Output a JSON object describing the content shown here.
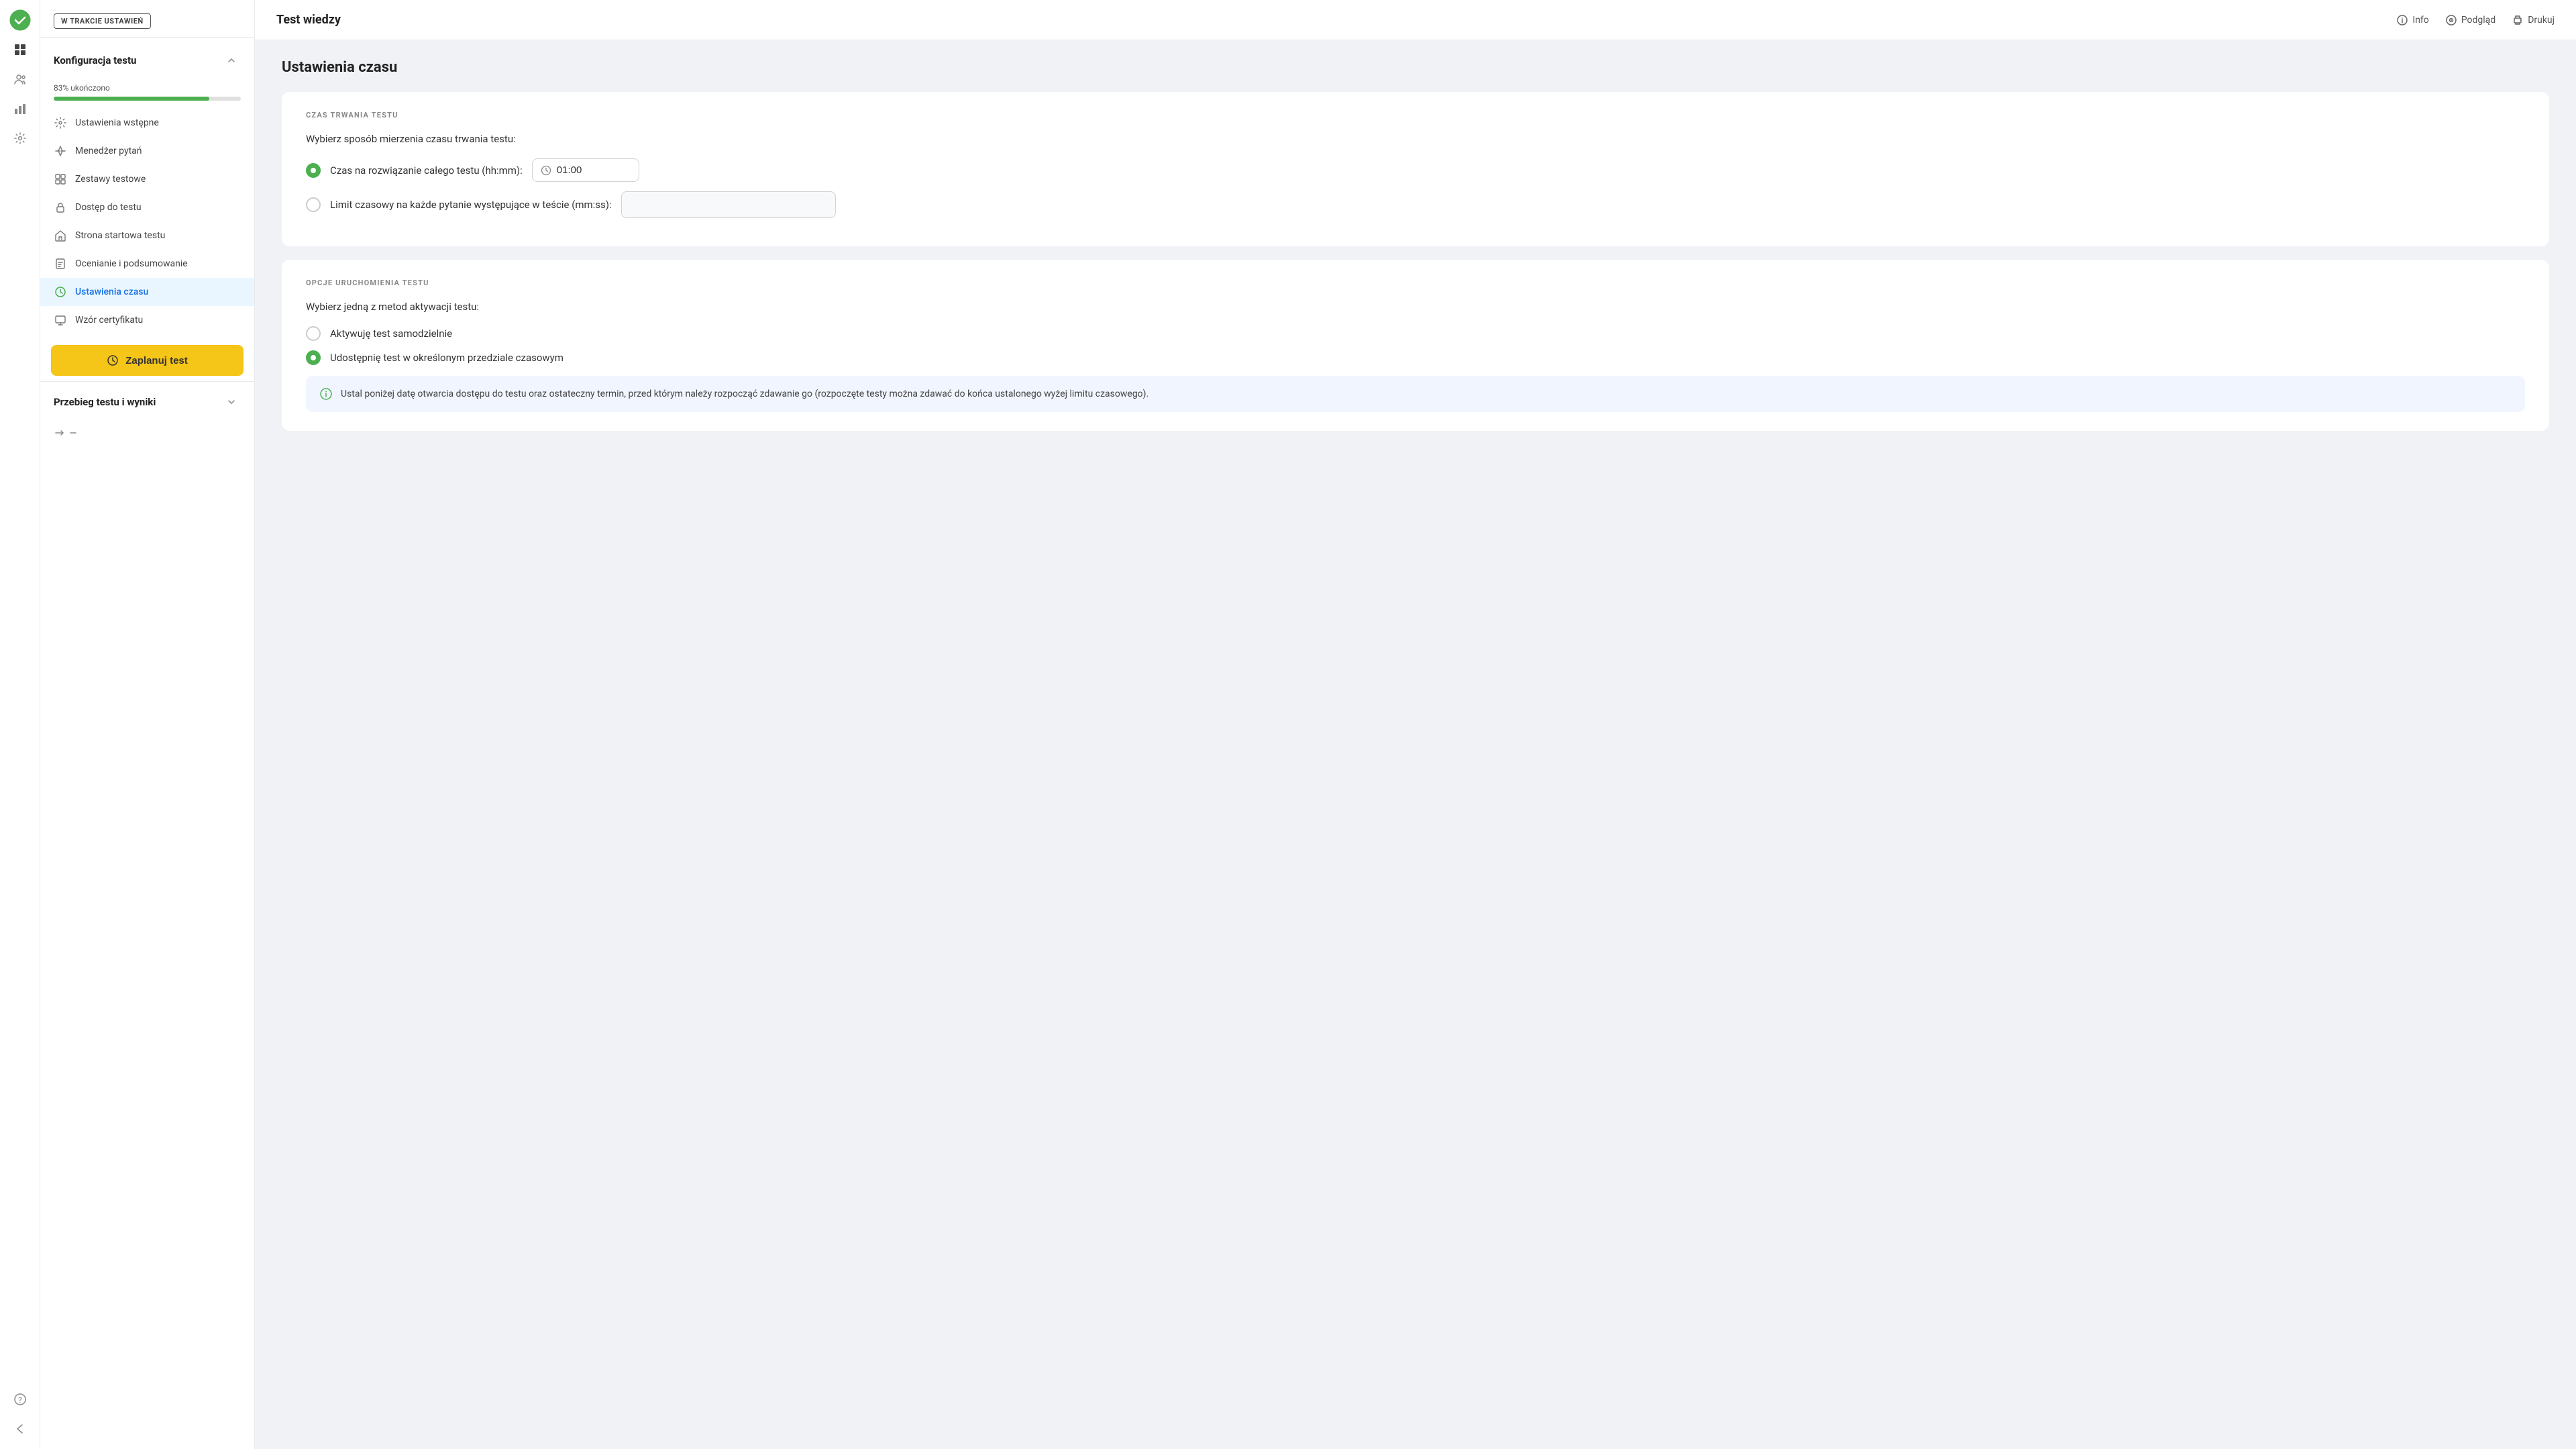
{
  "app": {
    "title": "Test wiedzy"
  },
  "topbar": {
    "title": "Test wiedzy",
    "actions": {
      "info": "Info",
      "preview": "Podgląd",
      "print": "Drukuj"
    }
  },
  "sidebar": {
    "status_badge": "W TRAKCIE USTAWIEŃ",
    "config_section": {
      "title": "Konfiguracja testu",
      "progress_label": "83% ukończono",
      "progress_value": 83
    },
    "nav_items": [
      {
        "id": "ustawienia-wstepne",
        "label": "Ustawienia wstępne",
        "icon": "⚙"
      },
      {
        "id": "menedzer-pytan",
        "label": "Menedżer pytań",
        "icon": "⇄"
      },
      {
        "id": "zestawy-testowe",
        "label": "Zestawy testowe",
        "icon": "▦"
      },
      {
        "id": "dostep-do-testu",
        "label": "Dostęp do testu",
        "icon": "🔒"
      },
      {
        "id": "strona-startowa",
        "label": "Strona startowa testu",
        "icon": "🏠"
      },
      {
        "id": "ocenianie",
        "label": "Ocenianie i podsumowanie",
        "icon": "📋"
      },
      {
        "id": "ustawienia-czasu",
        "label": "Ustawienia czasu",
        "icon": "⏰",
        "active": true
      },
      {
        "id": "wzor-certyfikatu",
        "label": "Wzór certyfikatu",
        "icon": "🏆"
      }
    ],
    "schedule_button": "Zaplanuj test",
    "results_section": {
      "title": "Przebieg testu i wyniki"
    }
  },
  "main": {
    "page_title": "Ustawienia czasu",
    "section_czas": {
      "label": "CZAS TRWANIA TESTU",
      "intro": "Wybierz sposób mierzenia czasu trwania testu:",
      "option1": {
        "label": "Czas na rozwiązanie całego testu (hh:mm):",
        "selected": true,
        "value": "01:00"
      },
      "option2": {
        "label": "Limit czasowy na każde pytanie występujące w teście (mm:ss):",
        "selected": false
      }
    },
    "section_opcje": {
      "label": "OPCJE URUCHOMIENIA TESTU",
      "intro": "Wybierz jedną z metod aktywacji testu:",
      "option1": {
        "label": "Aktywuję test samodzielnie",
        "selected": false
      },
      "option2": {
        "label": "Udostępnię test w określonym przedziale czasowym",
        "selected": true
      },
      "info_box": "Ustal poniżej datę otwarcia dostępu do testu oraz ostateczny termin, przed którym należy rozpocząć zdawanie go (rozpoczęte testy można zdawać do końca ustalonego wyżej limitu czasowego)."
    }
  }
}
